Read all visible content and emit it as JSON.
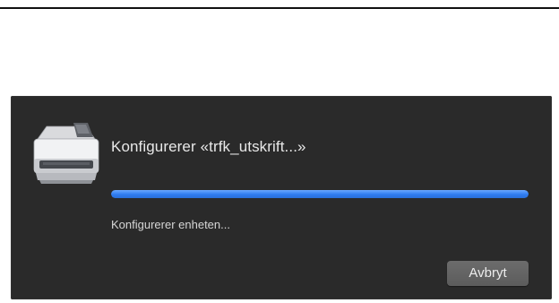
{
  "dialog": {
    "title": "Konfigurerer «trfk_utskrift...»",
    "status": "Konfigurerer enheten...",
    "progress_fraction": 1.0,
    "cancel_label": "Avbryt",
    "icon": "printer-icon"
  },
  "colors": {
    "dialog_background": "#2a2a2a",
    "progress_blue": "#2f7cf0",
    "button_background": "#646464"
  }
}
